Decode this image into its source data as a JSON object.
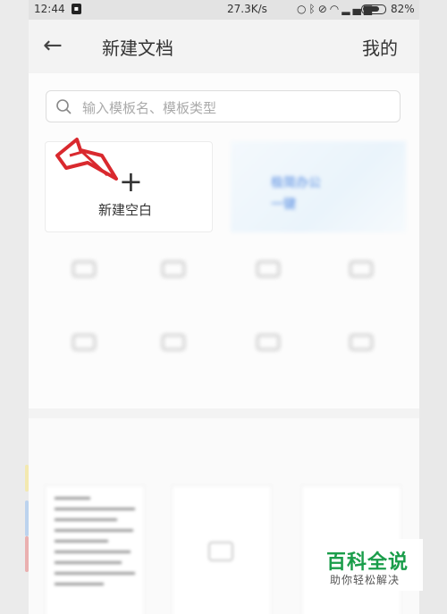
{
  "status_bar": {
    "time": "12:44",
    "notification_icon": "app-notification-icon",
    "net_speed": "27.3K/s",
    "icons": [
      "alarm-icon",
      "bluetooth-icon",
      "mute-icon",
      "wifi-icon",
      "signal-icon"
    ],
    "battery_level": 0.82,
    "battery_text": "82%"
  },
  "header": {
    "back_icon": "back-arrow-icon",
    "title": "新建文档",
    "mine_label": "我的"
  },
  "search": {
    "placeholder": "输入模板名、模板类型"
  },
  "new_blank": {
    "plus": "+",
    "label": "新建空白"
  },
  "banner": {
    "line1": "极简办公",
    "line2": "一键"
  },
  "template_grid": [],
  "lower_section": {
    "title": ""
  },
  "watermark": {
    "brand": "百科全说",
    "tagline": "助你轻松解决",
    "accent_color": "#1a9d4a"
  }
}
